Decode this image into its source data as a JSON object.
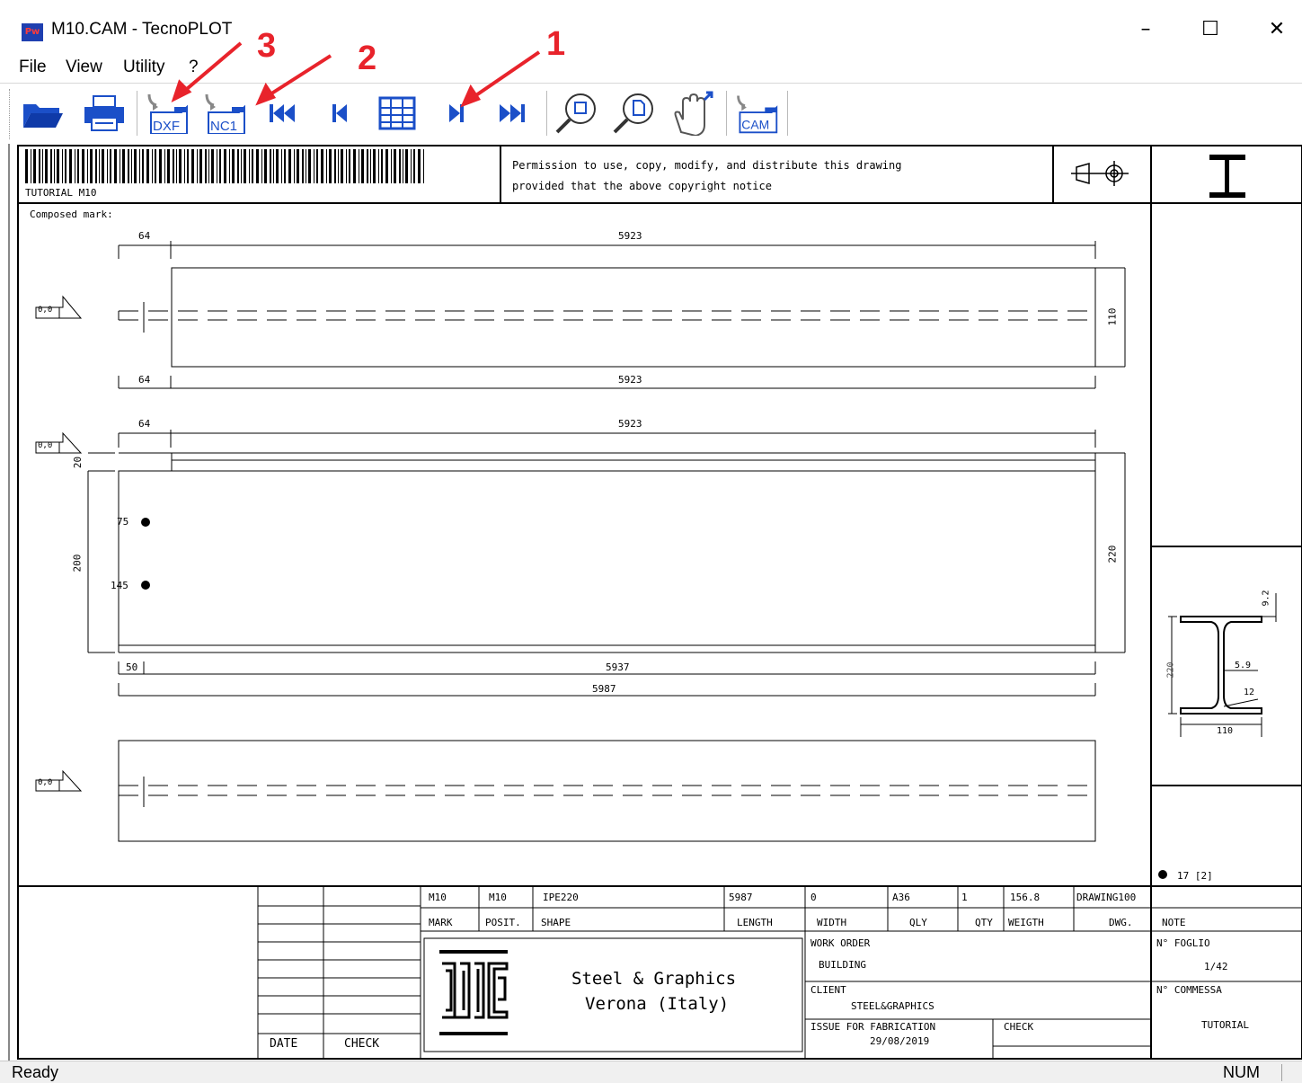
{
  "window": {
    "title": "M10.CAM - TecnoPLOT",
    "app_icon_text": "Pw"
  },
  "menu": {
    "items": [
      "File",
      "View",
      "Utility",
      "?"
    ]
  },
  "toolbar": {
    "buttons": [
      "open-folder-icon",
      "print-icon",
      "export-dxf-icon",
      "export-nc1-icon",
      "first-icon",
      "previous-icon",
      "table-icon",
      "next-icon",
      "last-icon",
      "zoom-window-icon",
      "zoom-page-icon",
      "pan-hand-icon",
      "export-cam-icon"
    ],
    "dxf_label": "DXF",
    "nc1_label": "NC1",
    "cam_label": "CAM"
  },
  "annotations": {
    "n1": "1",
    "n2": "2",
    "n3": "3",
    "color": "#e8232b"
  },
  "header": {
    "barcode_label": "TUTORIAL M10",
    "permission_line1": "Permission to use, copy, modify, and distribute this drawing",
    "permission_line2": "provided that the above copyright notice"
  },
  "drawing": {
    "composed_mark": "Composed mark:",
    "view1": {
      "dim_left_top": "64",
      "dim_top": "5923",
      "dim_left_bottom": "64",
      "dim_bottom": "5923",
      "dim_height": "110",
      "origin": "0,0"
    },
    "view2": {
      "dim_left_top": "64",
      "dim_top": "5923",
      "dim_flange": "20",
      "dim_left": "200",
      "dim_right": "220",
      "hole1": "75",
      "hole2": "145",
      "dim_bottom_left": "50",
      "dim_bottom": "5937",
      "dim_total": "5987",
      "origin": "0,0"
    },
    "view3": {
      "origin": "0,0"
    },
    "section": {
      "height": "220",
      "flange_thk": "9.2",
      "web_thk": "5.9",
      "radius": "12",
      "width": "110"
    },
    "hole_count": "17  [2]"
  },
  "title_block": {
    "row_values": [
      "M10",
      "M10",
      "IPE220",
      "5987",
      "0",
      "A36",
      "1",
      "156.8",
      "DRAWING100"
    ],
    "row_labels": [
      "MARK",
      "POSIT.",
      "SHAPE",
      "LENGTH",
      "WIDTH",
      "QLY",
      "QTY",
      "WEIGTH",
      "DWG.",
      "NOTE"
    ],
    "company_line1": "Steel & Graphics",
    "company_line2": "Verona (Italy)",
    "work_order_label": "WORK ORDER",
    "work_order": "BUILDING",
    "client_label": "CLIENT",
    "client": "STEEL&GRAPHICS",
    "issue_label": "ISSUE FOR FABRICATION",
    "issue_date": "29/08/2019",
    "check_label": "CHECK",
    "sheet_label": "N° FOGLIO",
    "sheet": "1/42",
    "order_label": "N° COMMESSA",
    "order": "TUTORIAL",
    "date_col": "DATE",
    "check_col": "CHECK"
  },
  "status": {
    "text": "Ready",
    "num": "NUM"
  }
}
